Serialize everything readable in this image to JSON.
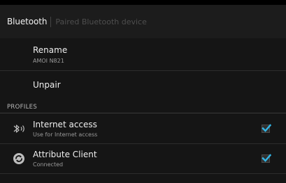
{
  "header": {
    "title": "Bluetooth",
    "subtitle": "Paired Bluetooth device"
  },
  "rename": {
    "label": "Rename",
    "value": "AMOI N821"
  },
  "unpair": {
    "label": "Unpair"
  },
  "profiles": {
    "section_label": "PROFILES",
    "items": [
      {
        "label": "Internet access",
        "summary": "Use for Internet access",
        "checked": true,
        "icon": "bluetooth-tethering-icon"
      },
      {
        "label": "Attribute Client",
        "summary": "Connected",
        "checked": true,
        "icon": "sync-icon"
      }
    ]
  },
  "colors": {
    "accent": "#33b5e5",
    "background": "#151515"
  }
}
